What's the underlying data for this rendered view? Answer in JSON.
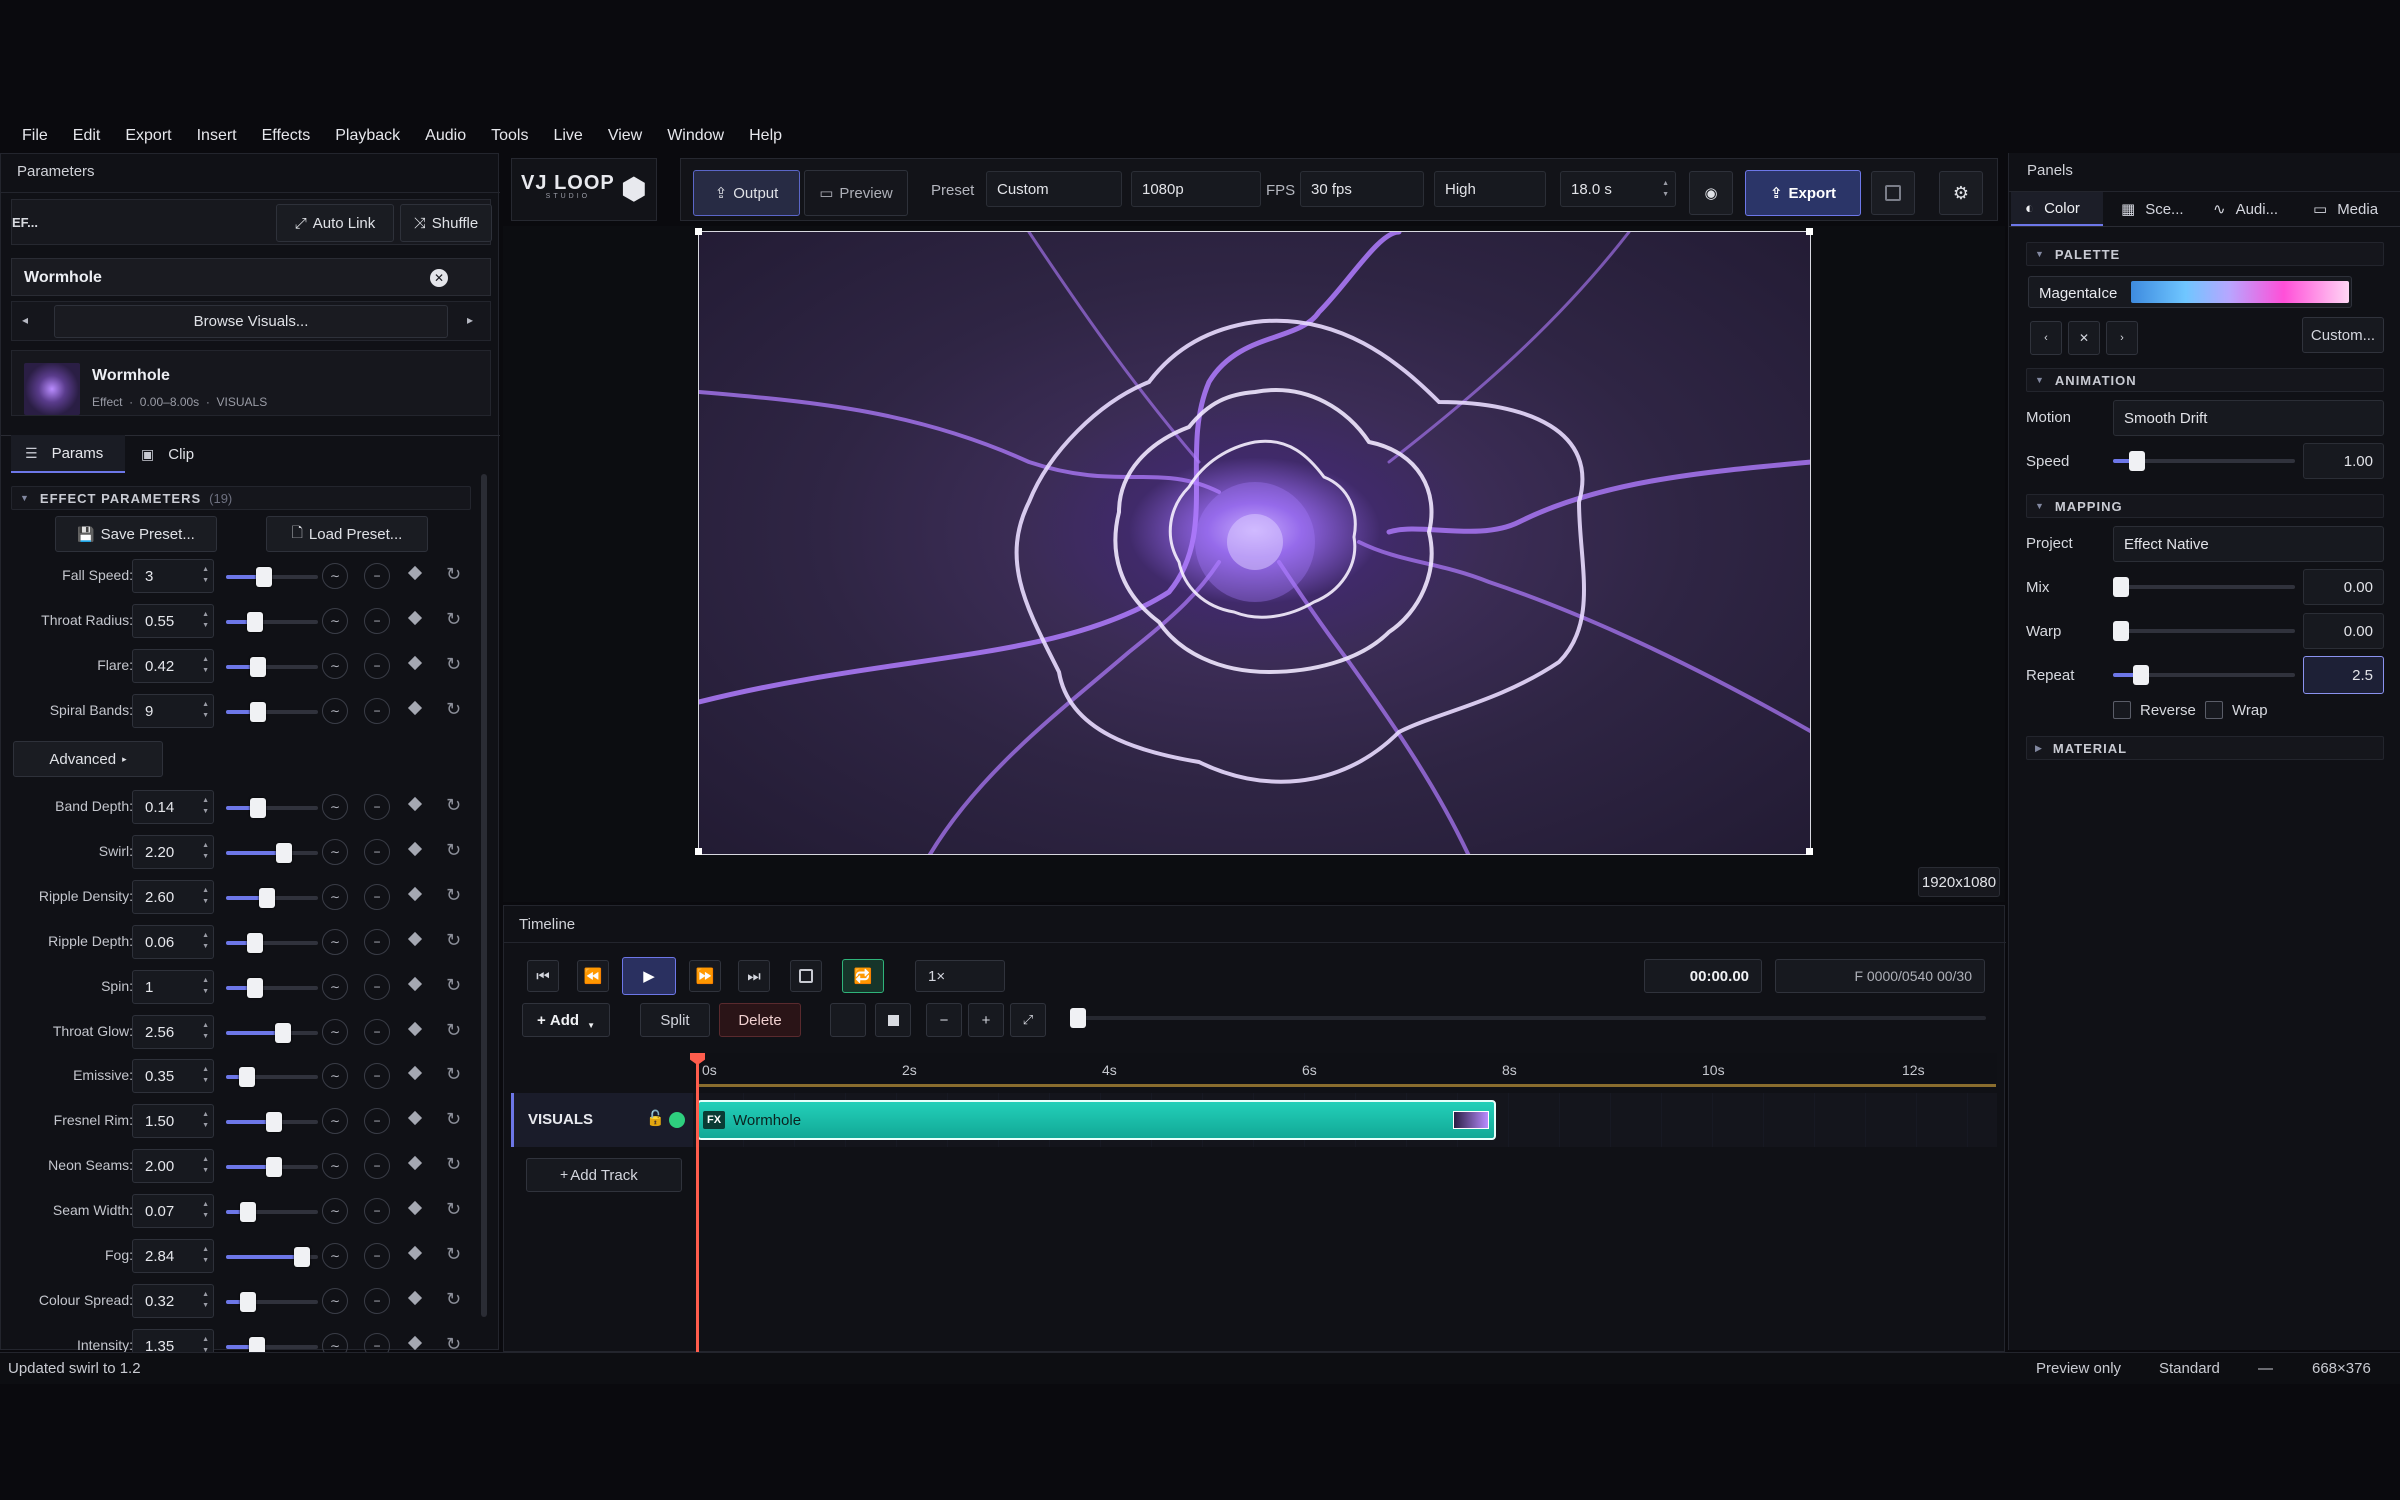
{
  "menu": [
    "File",
    "Edit",
    "Export",
    "Insert",
    "Effects",
    "Playback",
    "Audio",
    "Tools",
    "Live",
    "View",
    "Window",
    "Help"
  ],
  "left": {
    "title": "Parameters",
    "ef_label": "EF...",
    "auto_link": "Auto Link",
    "shuffle": "Shuffle",
    "current_effect": "Wormhole",
    "browse": "Browse Visuals...",
    "clip_name": "Wormhole",
    "clip_meta": "Effect  ·  0.00–8.00s  ·  VISUALS",
    "tab_params": "Params",
    "tab_clip": "Clip",
    "section_title": "EFFECT PARAMETERS",
    "section_count": "(19)",
    "save_preset": "Save Preset...",
    "load_preset": "Load Preset...",
    "advanced": "Advanced",
    "params_basic": [
      {
        "label": "Fall Speed:",
        "value": "3",
        "level": 0.4
      },
      {
        "label": "Throat Radius:",
        "value": "0.55",
        "level": 0.27
      },
      {
        "label": "Flare:",
        "value": "0.42",
        "level": 0.32
      },
      {
        "label": "Spiral Bands:",
        "value": "9",
        "level": 0.32
      }
    ],
    "params_advanced": [
      {
        "label": "Band Depth:",
        "value": "0.14",
        "level": 0.32
      },
      {
        "label": "Swirl:",
        "value": "2.20",
        "level": 0.66
      },
      {
        "label": "Ripple Density:",
        "value": "2.60",
        "level": 0.43
      },
      {
        "label": "Ripple Depth:",
        "value": "0.06",
        "level": 0.27
      },
      {
        "label": "Spin:",
        "value": "1",
        "level": 0.28
      },
      {
        "label": "Throat Glow:",
        "value": "2.56",
        "level": 0.64
      },
      {
        "label": "Emissive:",
        "value": "0.35",
        "level": 0.17
      },
      {
        "label": "Fresnel Rim:",
        "value": "1.50",
        "level": 0.52
      },
      {
        "label": "Neon Seams:",
        "value": "2.00",
        "level": 0.52
      },
      {
        "label": "Seam Width:",
        "value": "0.07",
        "level": 0.18
      },
      {
        "label": "Fog:",
        "value": "2.84",
        "level": 0.9
      },
      {
        "label": "Colour Spread:",
        "value": "0.32",
        "level": 0.18
      },
      {
        "label": "Intensity:",
        "value": "1.35",
        "level": 0.3
      }
    ]
  },
  "toolbar": {
    "logo": "VJ LOOP",
    "logo_sub": "STUDIO",
    "output": "Output",
    "preview": "Preview",
    "preset_label": "Preset",
    "preset_value": "Custom",
    "resolution": "1080p",
    "fps_label": "FPS",
    "fps_value": "30 fps",
    "quality": "High",
    "duration": "18.0 s",
    "export": "Export"
  },
  "canvas": {
    "resolution_badge": "1920x1080"
  },
  "timeline": {
    "title": "Timeline",
    "speed": "1×",
    "timecode": "00:00.00",
    "frame": "F 0000/0540  00/30",
    "add": "Add",
    "split": "Split",
    "delete": "Delete",
    "ruler": [
      "0s",
      "2s",
      "4s",
      "6s",
      "8s",
      "10s",
      "12s"
    ],
    "track_name": "VISUALS",
    "clip_badge": "FX",
    "clip_label": "Wormhole",
    "add_track": "Add Track"
  },
  "right": {
    "title": "Panels",
    "tabs": [
      "Color",
      "Sce...",
      "Audi...",
      "Media"
    ],
    "palette_section": "PALETTE",
    "palette_name": "MagentaIce",
    "custom_button": "Custom...",
    "animation_section": "ANIMATION",
    "motion_label": "Motion",
    "motion_value": "Smooth Drift",
    "speed_label": "Speed",
    "speed_value": "1.00",
    "mapping_section": "MAPPING",
    "project_label": "Project",
    "project_value": "Effect Native",
    "mix_label": "Mix",
    "mix_value": "0.00",
    "warp_label": "Warp",
    "warp_value": "0.00",
    "repeat_label": "Repeat",
    "repeat_value": "2.5",
    "reverse_label": "Reverse",
    "wrap_label": "Wrap",
    "material_section": "MATERIAL"
  },
  "status": {
    "message": "Updated swirl to 1.2",
    "preview_only": "Preview only",
    "standard": "Standard",
    "dash": "—",
    "size": "668×376"
  },
  "colors": {
    "accent": "#6d77e8",
    "clip": "#1bb8a6",
    "playhead": "#ff5d4d",
    "export": "#2b3568"
  }
}
